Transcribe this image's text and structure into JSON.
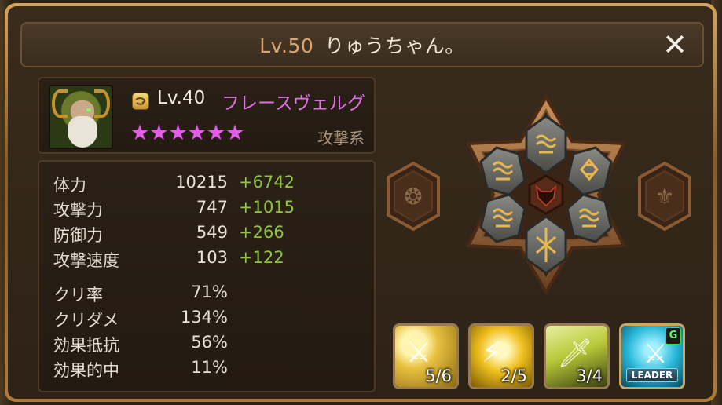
{
  "header": {
    "player_level": "Lv.50",
    "player_name": "りゅうちゃん。",
    "close_label": "✕"
  },
  "monster": {
    "element_icon": "wind-element-icon",
    "level": "Lv.40",
    "name": "フレースヴェルグ",
    "stars": 6,
    "star_color": "#e35ee8",
    "type": "攻撃系"
  },
  "stats": [
    {
      "label": "体力",
      "value": "10215",
      "bonus": "+6742"
    },
    {
      "label": "攻撃力",
      "value": "747",
      "bonus": "+1015"
    },
    {
      "label": "防御力",
      "value": "549",
      "bonus": "+266"
    },
    {
      "label": "攻撃速度",
      "value": "103",
      "bonus": "+122"
    },
    {
      "label": "クリ率",
      "value": "71%",
      "bonus": ""
    },
    {
      "label": "クリダメ",
      "value": "134%",
      "bonus": ""
    },
    {
      "label": "効果抵抗",
      "value": "56%",
      "bonus": ""
    },
    {
      "label": "効果的中",
      "value": "11%",
      "bonus": ""
    }
  ],
  "runes": {
    "center_icon": "demon-face-icon",
    "slots": [
      {
        "slot": 1,
        "icon": "wave-rune-icon"
      },
      {
        "slot": 2,
        "icon": "diamond-rune-icon"
      },
      {
        "slot": 3,
        "icon": "wave-rune-icon"
      },
      {
        "slot": 4,
        "icon": "cross-rune-icon"
      },
      {
        "slot": 5,
        "icon": "wave-rune-icon"
      },
      {
        "slot": 6,
        "icon": "wave-rune-icon"
      }
    ],
    "left_artifact_icon": "element-artifact-icon",
    "right_artifact_icon": "fleur-artifact-icon"
  },
  "skills": [
    {
      "level": "5/6",
      "icon": "sword-strike-icon"
    },
    {
      "level": "2/5",
      "icon": "lightning-blade-icon"
    },
    {
      "level": "3/4",
      "icon": "beast-slash-icon"
    },
    {
      "label": "LEADER",
      "badge": "G",
      "icon": "leader-sword-icon"
    }
  ],
  "colors": {
    "bonus_green": "#8ec63f",
    "name_pink": "#e070e6",
    "frame_gold": "#d8a45a"
  }
}
